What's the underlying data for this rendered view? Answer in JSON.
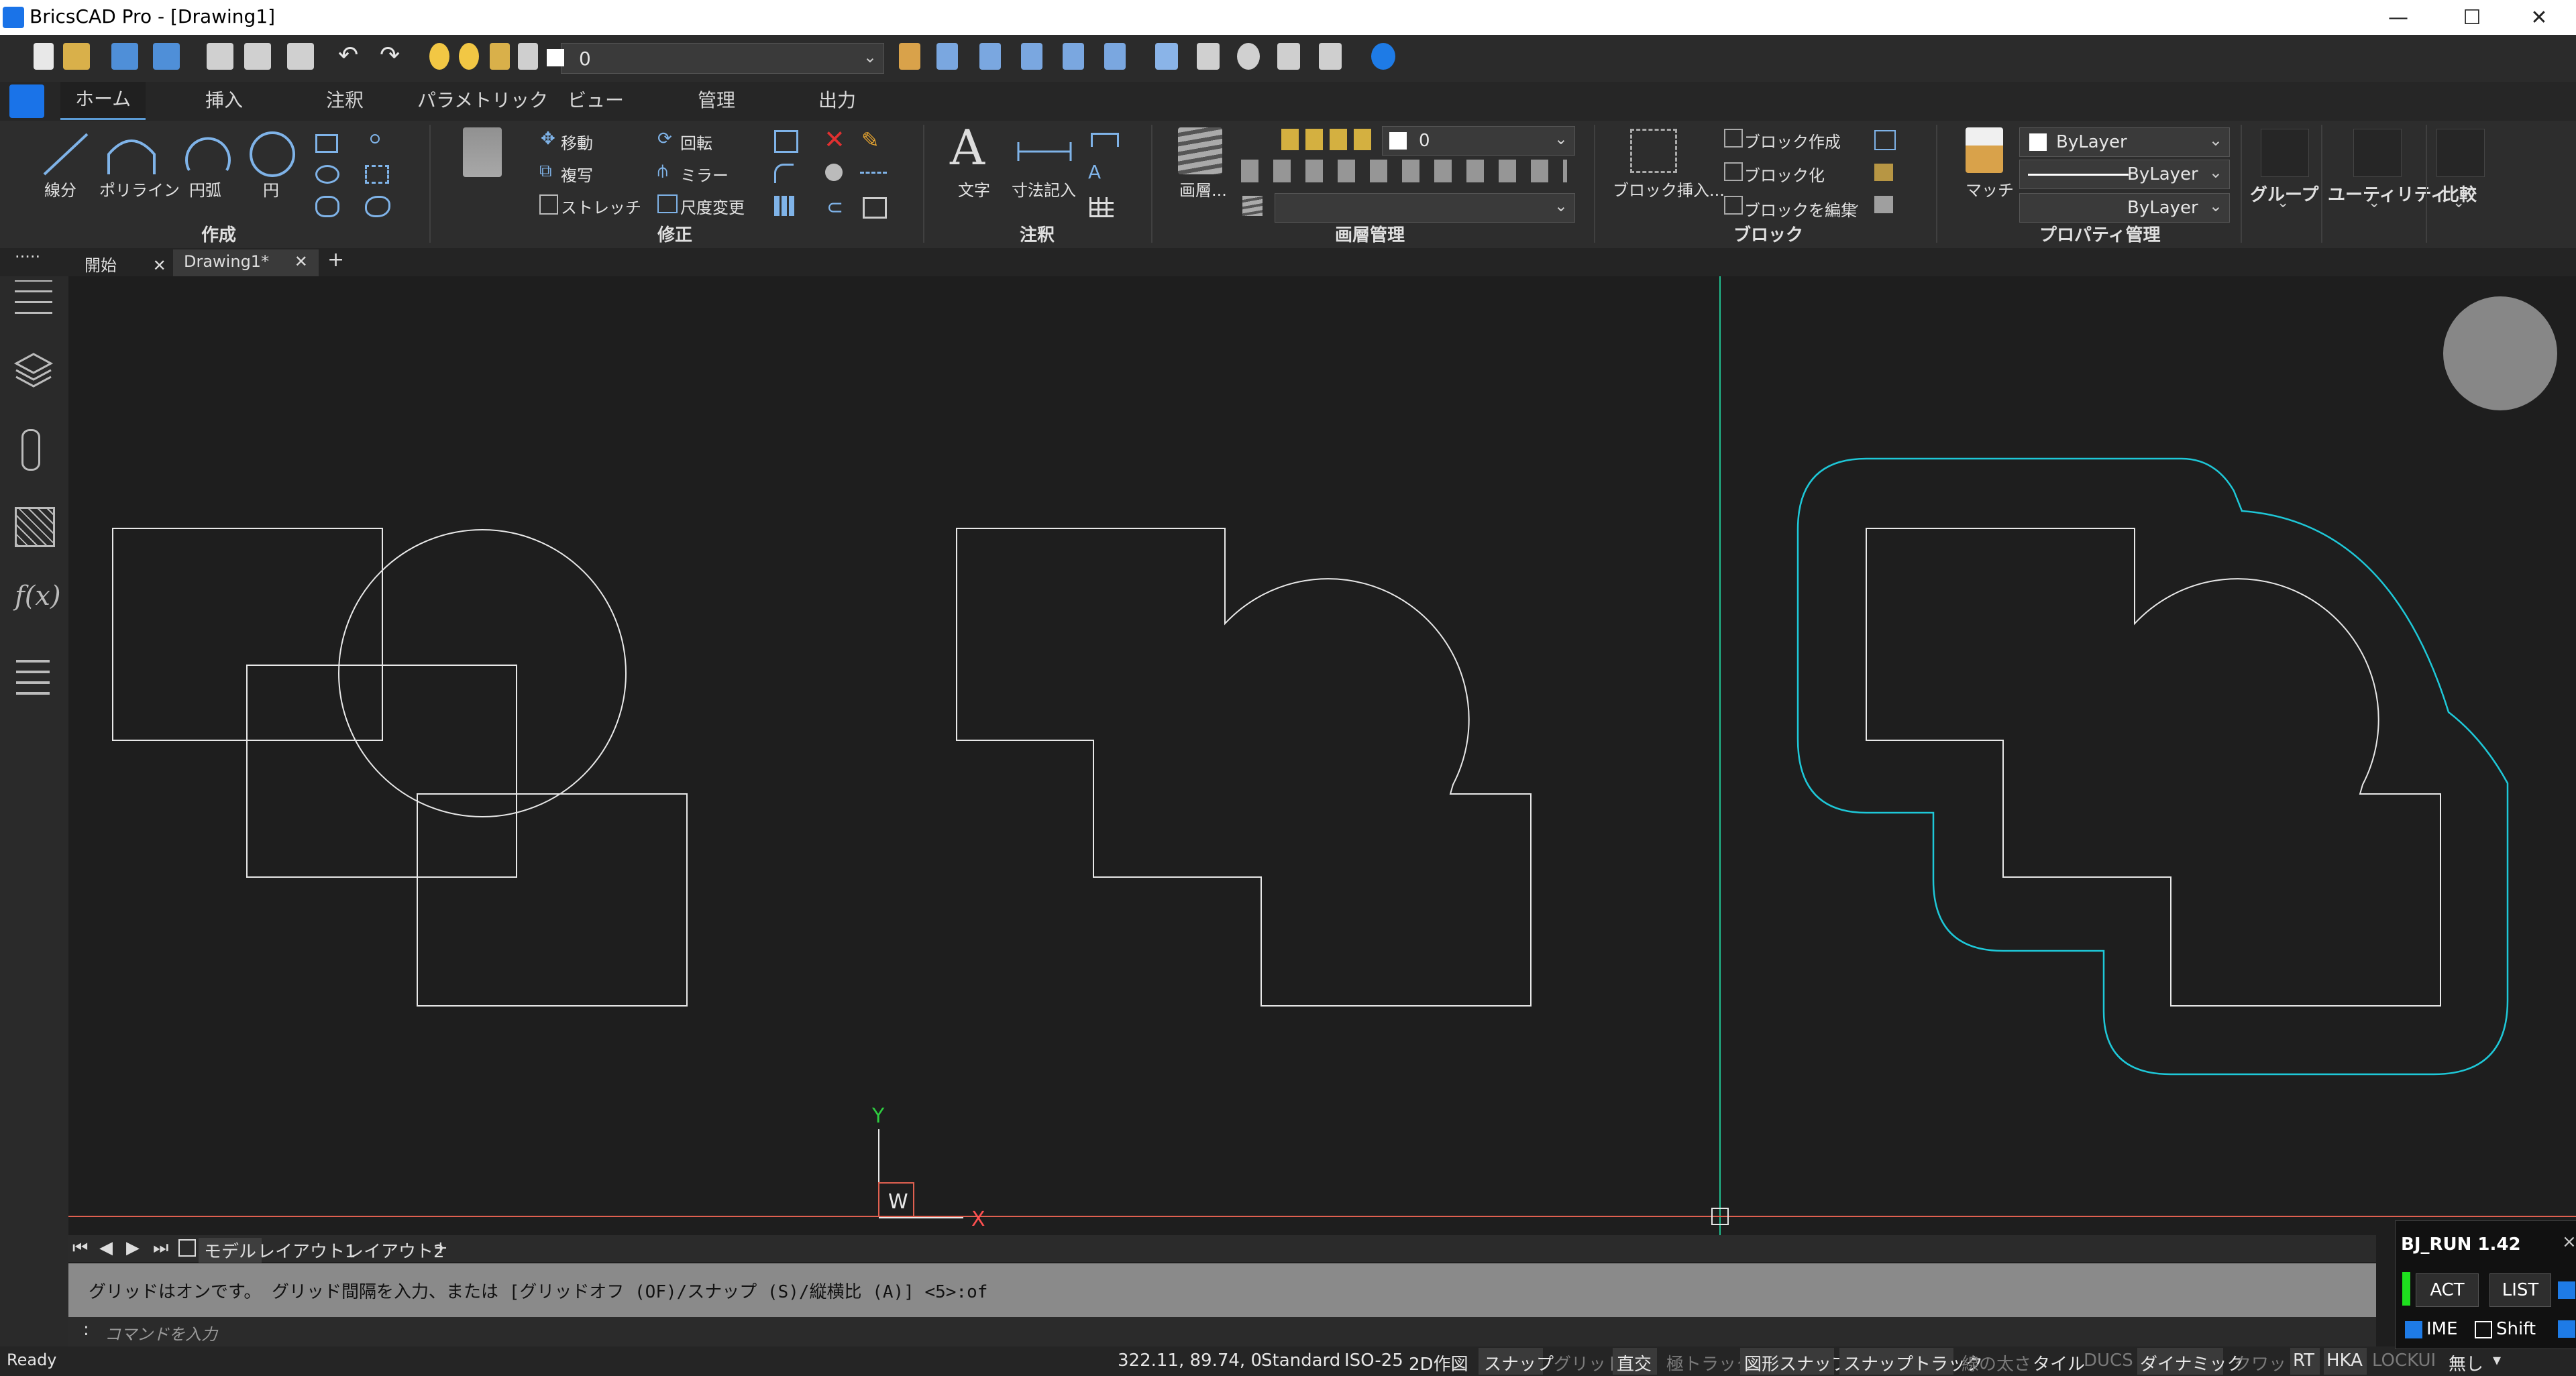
{
  "app": {
    "title": "BricsCAD Pro - [Drawing1]"
  },
  "window": {
    "minimize": "—",
    "maximize": "☐",
    "close": "✕"
  },
  "qat": {
    "layer_value": "0"
  },
  "ribbon_tabs": [
    "ホーム",
    "挿入",
    "注釈",
    "パラメトリック",
    "ビュー",
    "管理",
    "出力"
  ],
  "draw_panel": {
    "line": "線分",
    "polyline": "ポリライン",
    "arc": "円弧",
    "circle": "円",
    "label": "作成"
  },
  "modify_panel": {
    "move": "移動",
    "copy": "複写",
    "stretch": "ストレッチ",
    "rotate": "回転",
    "mirror": "ミラー",
    "scale": "尺度変更",
    "label": "修正"
  },
  "annotation_panel": {
    "text": "文字",
    "dimension": "寸法記入",
    "label": "注釈"
  },
  "layer_panel": {
    "layer_button": "画層...",
    "current_layer": "0",
    "label": "画層管理"
  },
  "block_panel": {
    "insert": "ブロック挿入...",
    "create": "ブロック作成",
    "blockify": "ブロック化",
    "edit": "ブロックを編集",
    "label": "ブロック"
  },
  "properties_panel": {
    "match": "マッチ",
    "color": "ByLayer",
    "linetype": "ByLayer",
    "lineweight": "ByLayer",
    "label": "プロパティ管理"
  },
  "extra_panels": {
    "group": "グループ",
    "utilities": "ユーティリティ",
    "compare": "比較"
  },
  "doc_tabs": {
    "start": "開始",
    "drawing": "Drawing1*",
    "add": "+",
    "overflow": "....."
  },
  "layout_tabs": {
    "model": "モデル",
    "layout1": "レイアウト1",
    "layout2": "レイアウト2",
    "add": "+"
  },
  "ucs": {
    "y": "Y",
    "x": "X",
    "w": "W"
  },
  "command": {
    "history": "グリッドはオンです。 グリッド間隔を入力、または [グリッドオフ (OF)/スナップ (S)/縦横比 (A)] <5>:of",
    "prompt_marker": ":",
    "placeholder": "コマンドを入力",
    "close": "×"
  },
  "status": {
    "ready": "Ready",
    "coords": "322.11, 89.74, 0",
    "textstyle": "Standard",
    "dimstyle": "ISO-25",
    "workspace": "2D作図",
    "toggles": [
      {
        "label": "スナップ",
        "on": true
      },
      {
        "label": "グリッド",
        "on": false
      },
      {
        "label": "直交",
        "on": true
      },
      {
        "label": "極トラック",
        "on": false
      },
      {
        "label": "図形スナップ",
        "on": true
      },
      {
        "label": "スナップトラック",
        "on": true
      },
      {
        "label": "線の太さ",
        "on": false
      },
      {
        "label": "タイル",
        "on": true
      },
      {
        "label": "DUCS",
        "on": false
      },
      {
        "label": "ダイナミック",
        "on": true
      },
      {
        "label": "クワッド",
        "on": false
      },
      {
        "label": "RT",
        "on": true
      },
      {
        "label": "HKA",
        "on": true
      },
      {
        "label": "LOCKUI",
        "on": false
      },
      {
        "label": "無し",
        "on": true
      }
    ]
  },
  "bj_panel": {
    "title": "BJ_RUN 1.42",
    "act": "ACT",
    "list": "LIST",
    "ime": "IME",
    "shift": "Shift",
    "close": "×"
  },
  "colors": {
    "accent": "#5b9bd5",
    "offset_curve": "#1ec8d8",
    "crosshair_v": "#20c090",
    "crosshair_h": "#e06050",
    "ucs_y": "#2ecc40",
    "ucs_x": "#ff5050"
  }
}
